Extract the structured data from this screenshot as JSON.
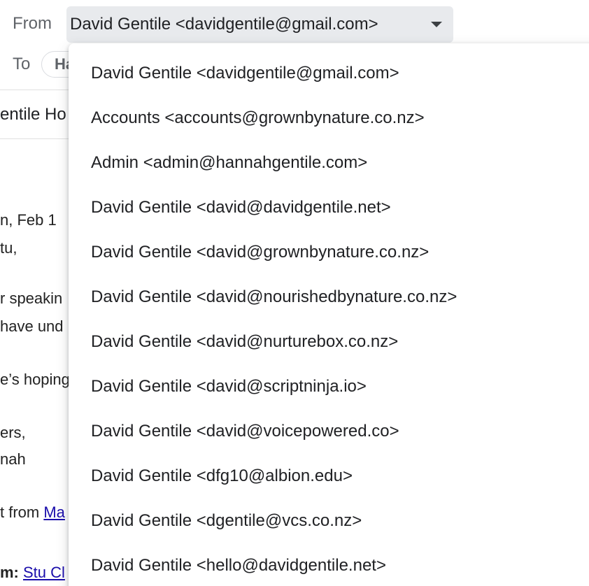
{
  "compose": {
    "from_label": "From",
    "from_value": "David Gentile <davidgentile@gmail.com>",
    "to_label": "To",
    "recipient_chip": "Ha",
    "subject_fragment": "entile Ho"
  },
  "body": {
    "line1": "n, Feb 1",
    "line2": "tu,",
    "line3": "r speakin",
    "line4": "have und",
    "line5": "e’s hoping",
    "line6": "ers,",
    "line7": "nah",
    "line8_prefix": "t from ",
    "line8_link": "Ma",
    "line9_bold": "m: ",
    "line9_link": "Stu Cl"
  },
  "menu": {
    "items": [
      "David Gentile <davidgentile@gmail.com>",
      "Accounts <accounts@grownbynature.co.nz>",
      "Admin <admin@hannahgentile.com>",
      "David Gentile <david@davidgentile.net>",
      "David Gentile <david@grownbynature.co.nz>",
      "David Gentile <david@nourishedbynature.co.nz>",
      "David Gentile <david@nurturebox.co.nz>",
      "David Gentile <david@scriptninja.io>",
      "David Gentile <david@voicepowered.co>",
      "David Gentile <dfg10@albion.edu>",
      "David Gentile <dgentile@vcs.co.nz>",
      "David Gentile <hello@davidgentile.net>"
    ]
  }
}
